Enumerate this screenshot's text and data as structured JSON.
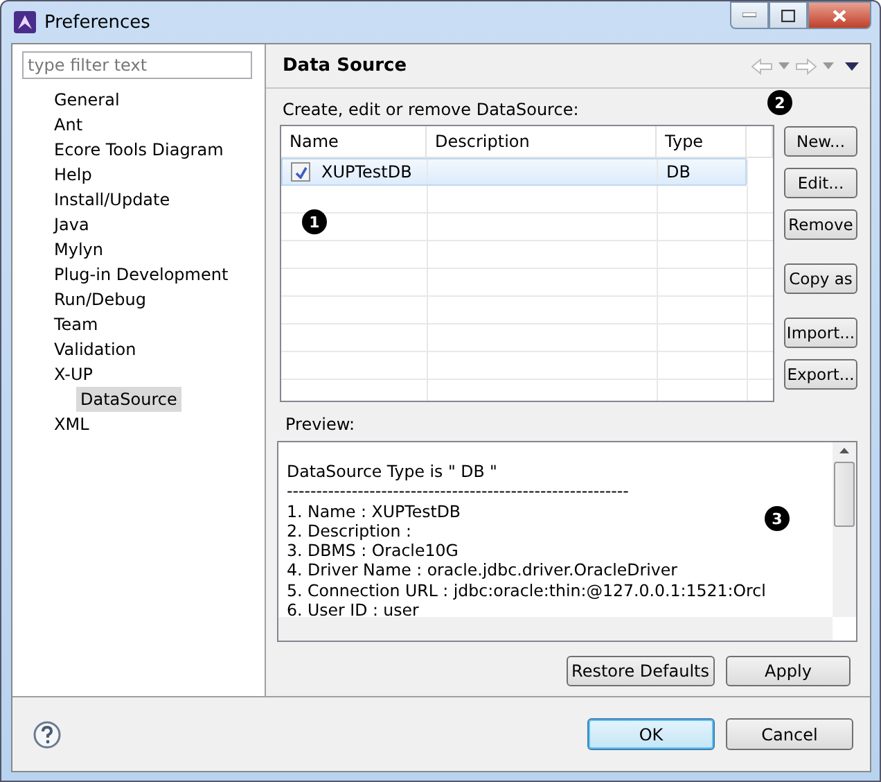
{
  "window": {
    "title": "Preferences"
  },
  "filter": {
    "placeholder": "type filter text"
  },
  "tree": [
    {
      "label": "General",
      "selected": false
    },
    {
      "label": "Ant",
      "selected": false
    },
    {
      "label": "Ecore Tools Diagram",
      "selected": false
    },
    {
      "label": "Help",
      "selected": false
    },
    {
      "label": "Install/Update",
      "selected": false
    },
    {
      "label": "Java",
      "selected": false
    },
    {
      "label": "Mylyn",
      "selected": false
    },
    {
      "label": "Plug-in Development",
      "selected": false
    },
    {
      "label": "Run/Debug",
      "selected": false
    },
    {
      "label": "Team",
      "selected": false
    },
    {
      "label": "Validation",
      "selected": false
    },
    {
      "label": "X-UP",
      "selected": false,
      "children": [
        {
          "label": "DataSource",
          "selected": true
        }
      ]
    },
    {
      "label": "XML",
      "selected": false
    }
  ],
  "page": {
    "title": "Data Source",
    "intro": "Create, edit or remove DataSource:"
  },
  "table": {
    "columns": [
      "Name",
      "Description",
      "Type"
    ],
    "rows": [
      {
        "checked": true,
        "selected": true,
        "cells": [
          "XUPTestDB",
          "",
          "DB"
        ]
      }
    ]
  },
  "side_buttons": [
    "New...",
    "Edit...",
    "Remove",
    "Copy as",
    "Import...",
    "Export..."
  ],
  "preview": {
    "label": "Preview:",
    "lines": [
      "DataSource Type is \" DB \"",
      "----------------------------------------------------------",
      "1. Name : XUPTestDB",
      "2. Description :",
      "3. DBMS : Oracle10G",
      "4. Driver Name : oracle.jdbc.driver.OracleDriver",
      "5. Connection URL :  jdbc:oracle:thin:@127.0.0.1:1521:Orcl",
      "6. User ID : user"
    ]
  },
  "page_buttons": [
    "Restore Defaults",
    "Apply"
  ],
  "dialog_buttons": [
    {
      "label": "OK",
      "default": true
    },
    {
      "label": "Cancel",
      "default": false
    }
  ],
  "callouts": [
    "1",
    "2",
    "3"
  ]
}
